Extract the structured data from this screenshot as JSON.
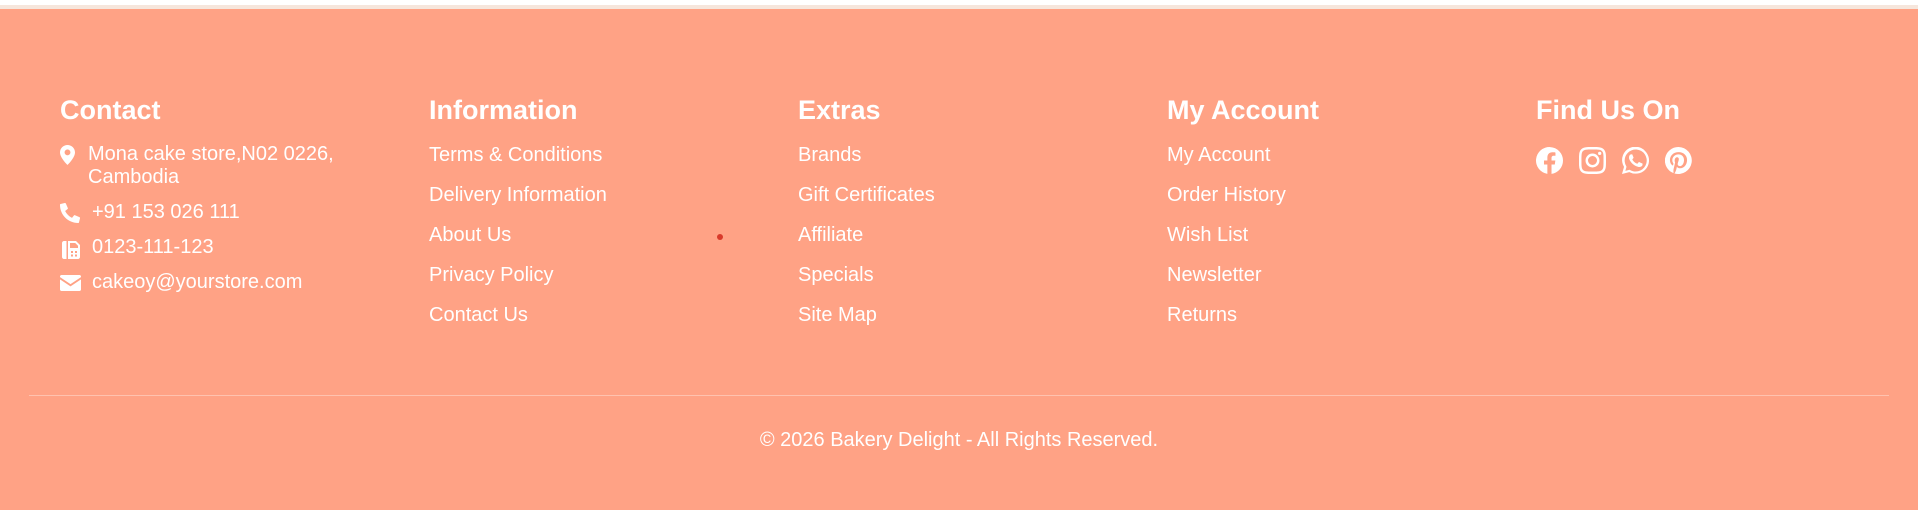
{
  "footer": {
    "contact": {
      "heading": "Contact",
      "address": "Mona cake store,N02 0226, Cambodia",
      "phone": "+91 153 026 111",
      "fax": "0123-111-123",
      "email": "cakeoy@yourstore.com"
    },
    "information": {
      "heading": "Information",
      "links": [
        "Terms & Conditions",
        "Delivery Information",
        "About Us",
        "Privacy Policy",
        "Contact Us"
      ]
    },
    "extras": {
      "heading": "Extras",
      "links": [
        "Brands",
        "Gift Certificates",
        "Affiliate",
        "Specials",
        "Site Map"
      ]
    },
    "account": {
      "heading": "My Account",
      "links": [
        "My Account",
        "Order History",
        "Wish List",
        "Newsletter",
        "Returns"
      ]
    },
    "social": {
      "heading": "Find Us On",
      "icons": [
        "facebook-icon",
        "instagram-icon",
        "whatsapp-icon",
        "pinterest-icon"
      ]
    },
    "copyright": "© 2026 Bakery Delight - All Rights Reserved.",
    "colors": {
      "background": "#ffa285",
      "text": "#ffffff"
    }
  }
}
